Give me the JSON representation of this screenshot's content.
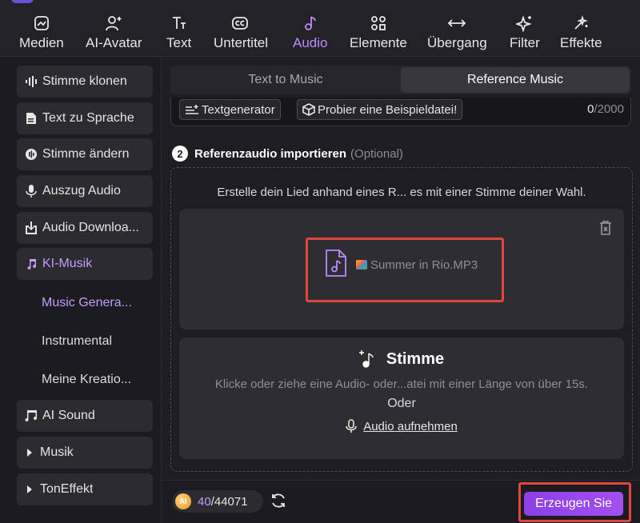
{
  "topbar": {
    "tabs": [
      {
        "label": "Medien",
        "icon": "media-icon"
      },
      {
        "label": "AI-Avatar",
        "icon": "avatar-icon"
      },
      {
        "label": "Text",
        "icon": "text-icon"
      },
      {
        "label": "Untertitel",
        "icon": "subtitle-icon"
      },
      {
        "label": "Audio",
        "icon": "audio-icon",
        "active": true
      },
      {
        "label": "Elemente",
        "icon": "elements-icon"
      },
      {
        "label": "Übergang",
        "icon": "transition-icon"
      },
      {
        "label": "Filter",
        "icon": "filter-icon"
      },
      {
        "label": "Effekte",
        "icon": "effects-icon"
      }
    ]
  },
  "sidebar": {
    "items": [
      {
        "label": "Stimme klonen",
        "icon": "waveform-icon"
      },
      {
        "label": "Text zu Sprache",
        "icon": "document-icon"
      },
      {
        "label": "Stimme ändern",
        "icon": "voice-change-icon"
      },
      {
        "label": "Auszug Audio",
        "icon": "microphone-icon"
      },
      {
        "label": "Audio Downloa...",
        "icon": "download-icon"
      },
      {
        "label": "KI-Musik",
        "icon": "music-note-icon",
        "active": true
      },
      {
        "label": "AI Sound",
        "icon": "sound-icon"
      },
      {
        "label": "Musik",
        "icon": "caret-right-icon"
      },
      {
        "label": "TonEffekt",
        "icon": "caret-right-icon"
      }
    ],
    "subitems": [
      {
        "label": "Music Genera...",
        "active": true
      },
      {
        "label": "Instrumental"
      },
      {
        "label": "Meine Kreatio..."
      }
    ]
  },
  "main": {
    "segments": {
      "left": "Text to Music",
      "right": "Reference Music",
      "active": "right"
    },
    "textarea_tools": {
      "text_generator": "Textgenerator",
      "sample_file": "Probier eine Beispieldatei!",
      "count_current": "0",
      "count_max": "/2000"
    },
    "section": {
      "number": "2",
      "title": "Referenzaudio importieren",
      "optional": "(Optional)"
    },
    "dropzone_desc": "Erstelle dein Lied anhand eines R... es mit einer Stimme deiner Wahl.",
    "file": {
      "name": "Summer in Rio.MP3"
    },
    "voice": {
      "title": "Stimme",
      "desc": "Klicke oder ziehe eine Audio- oder...atei mit einer Länge von über 15s.",
      "or": "Oder",
      "record": "Audio aufnehmen"
    }
  },
  "bottombar": {
    "coin_label": "AI",
    "credits_used": "40",
    "credits_total": "/44071",
    "generate": "Erzeugen Sie"
  },
  "colors": {
    "accent": "#b98cff",
    "highlight": "#e0473c",
    "button": "#9a48ec"
  }
}
